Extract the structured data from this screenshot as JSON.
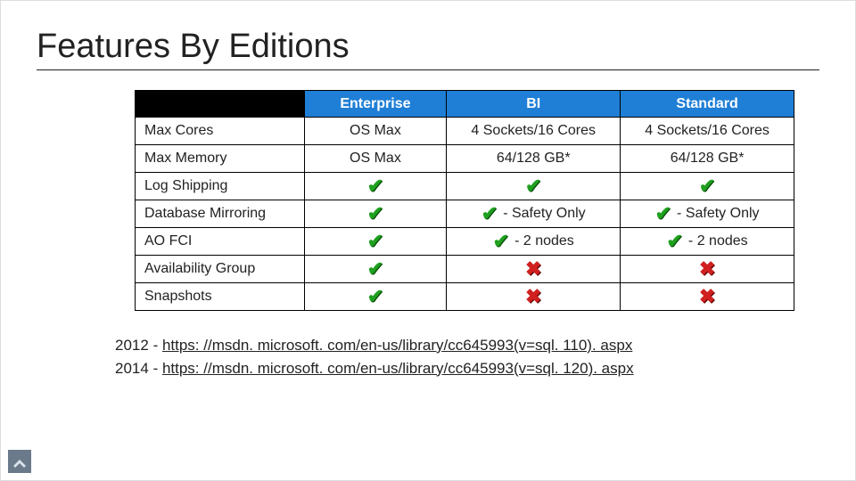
{
  "title": "Features By Editions",
  "editions": [
    "Enterprise",
    "BI",
    "Standard"
  ],
  "features": [
    "Max Cores",
    "Max Memory",
    "Log Shipping",
    "Database Mirroring",
    "AO FCI",
    "Availability Group",
    "Snapshots"
  ],
  "cells": {
    "max_cores": {
      "ent": {
        "text": "OS Max"
      },
      "bi": {
        "text": "4 Sockets/16 Cores"
      },
      "std": {
        "text": "4 Sockets/16 Cores"
      }
    },
    "max_memory": {
      "ent": {
        "text": "OS Max"
      },
      "bi": {
        "text": "64/128 GB*"
      },
      "std": {
        "text": "64/128 GB*"
      }
    },
    "log_shipping": {
      "ent": {
        "icon": "check"
      },
      "bi": {
        "icon": "check"
      },
      "std": {
        "icon": "check"
      }
    },
    "db_mirroring": {
      "ent": {
        "icon": "check"
      },
      "bi": {
        "icon": "check",
        "text": "- Safety Only"
      },
      "std": {
        "icon": "check",
        "text": "- Safety Only"
      }
    },
    "ao_fci": {
      "ent": {
        "icon": "check"
      },
      "bi": {
        "icon": "check",
        "text": "- 2 nodes"
      },
      "std": {
        "icon": "check",
        "text": "- 2 nodes"
      }
    },
    "avail_group": {
      "ent": {
        "icon": "check"
      },
      "bi": {
        "icon": "cross"
      },
      "std": {
        "icon": "cross"
      }
    },
    "snapshots": {
      "ent": {
        "icon": "check"
      },
      "bi": {
        "icon": "cross"
      },
      "std": {
        "icon": "cross"
      }
    }
  },
  "links": [
    {
      "year": "2012",
      "url": "https: //msdn. microsoft. com/en-us/library/cc645993(v=sql. 110). aspx"
    },
    {
      "year": "2014",
      "url": "https: //msdn. microsoft. com/en-us/library/cc645993(v=sql. 120). aspx"
    }
  ]
}
